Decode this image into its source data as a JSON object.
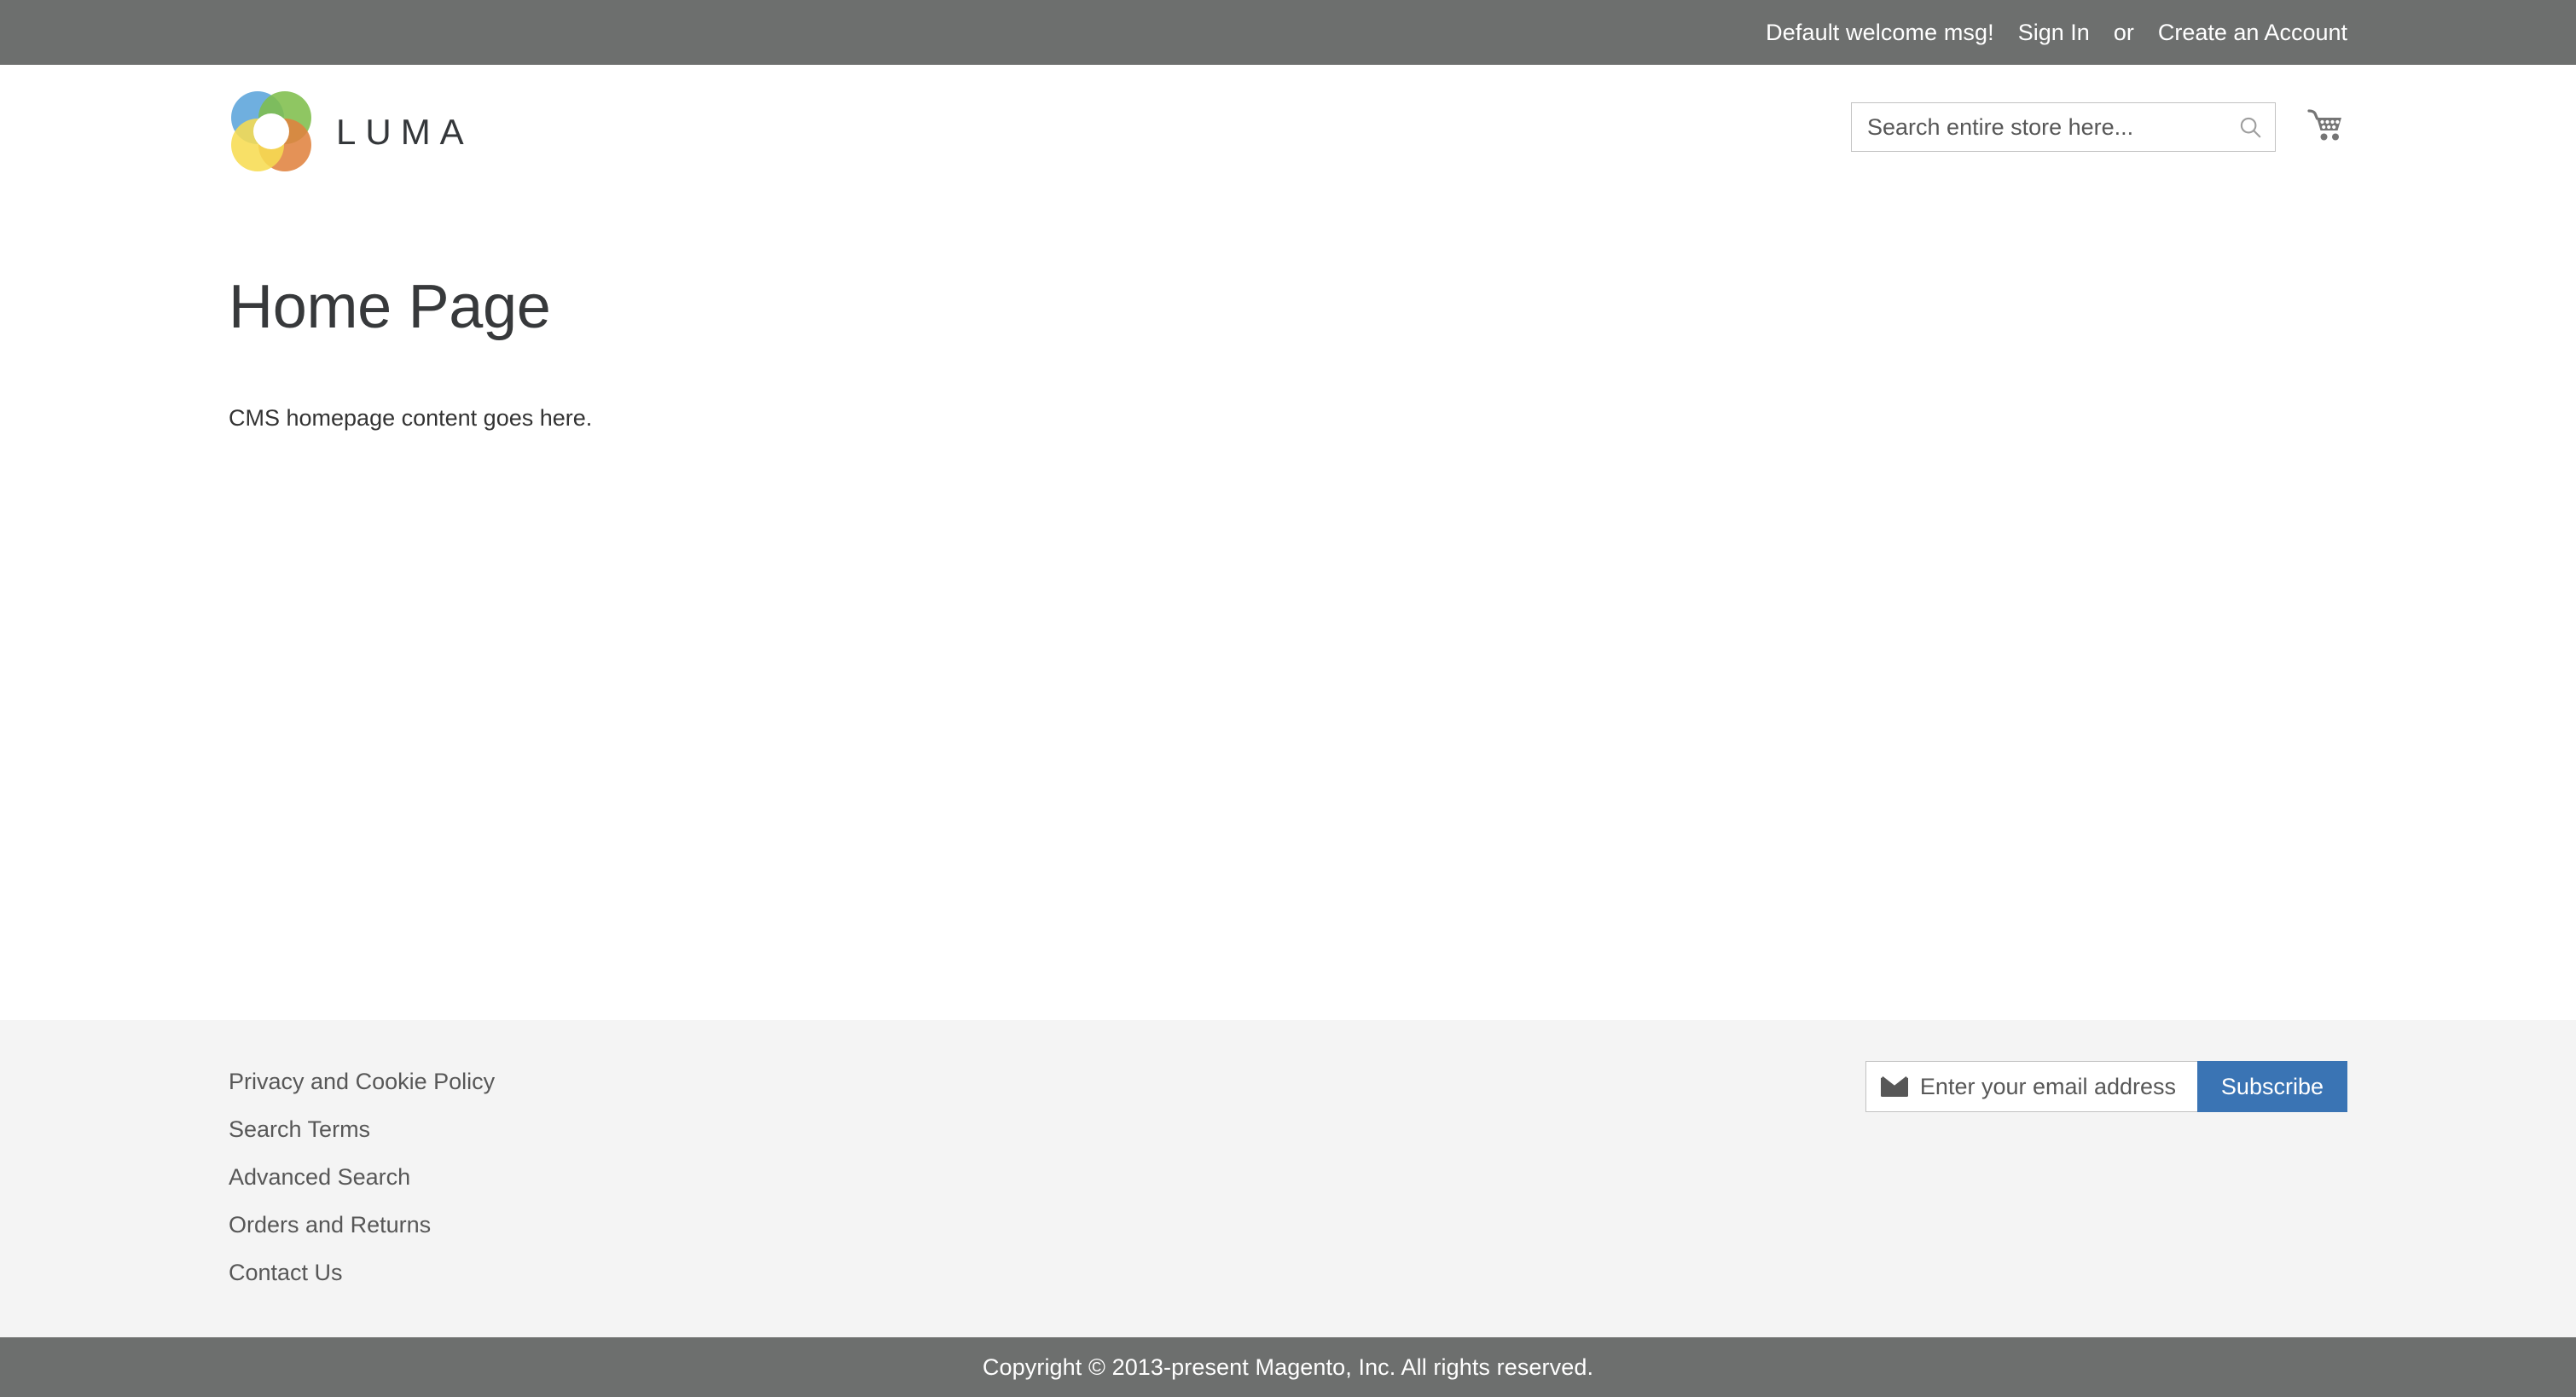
{
  "top_panel": {
    "welcome_message": "Default welcome msg!",
    "sign_in_label": "Sign In",
    "separator": "or",
    "create_account_label": "Create an Account"
  },
  "header": {
    "logo_text": "LUMA",
    "logo_icon": "luma-flower-logo",
    "logo_colors": {
      "blue": "#5ba4db",
      "green": "#7fbe4c",
      "yellow": "#f7dc52",
      "orange": "#e08340"
    },
    "search": {
      "placeholder": "Search entire store here...",
      "value": "",
      "icon": "search-icon"
    },
    "cart": {
      "icon": "shopping-cart-icon",
      "count": ""
    }
  },
  "main": {
    "page_title": "Home Page",
    "cms_content": "CMS homepage content goes here."
  },
  "footer": {
    "links": [
      {
        "label": "Privacy and Cookie Policy"
      },
      {
        "label": "Search Terms"
      },
      {
        "label": "Advanced Search"
      },
      {
        "label": "Orders and Returns"
      },
      {
        "label": "Contact Us"
      }
    ],
    "newsletter": {
      "icon": "envelope-icon",
      "placeholder": "Enter your email address",
      "value": "",
      "subscribe_label": "Subscribe",
      "subscribe_color": "#3a74b4"
    }
  },
  "copyright": {
    "text": "Copyright © 2013-present Magento, Inc. All rights reserved."
  },
  "colors": {
    "top_bar_gray": "#6d6f6e",
    "footer_gray": "#f4f4f4",
    "text_dark": "#34373a",
    "text_body": "#575757"
  }
}
